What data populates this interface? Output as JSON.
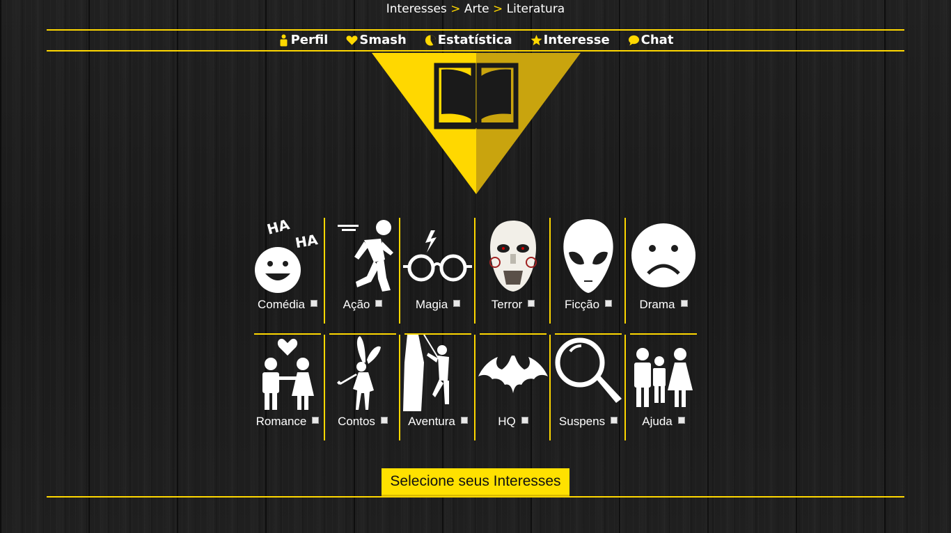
{
  "breadcrumb": {
    "items": [
      "Interesses",
      "Arte",
      "Literatura"
    ],
    "separator": ">"
  },
  "nav": {
    "items": [
      {
        "label": "Perfil",
        "icon": "person-icon"
      },
      {
        "label": "Smash",
        "icon": "heart-icon"
      },
      {
        "label": "Estatística",
        "icon": "pie-chart-icon"
      },
      {
        "label": "Interesse",
        "icon": "star-icon"
      },
      {
        "label": "Chat",
        "icon": "speech-bubble-icon"
      }
    ]
  },
  "hero": {
    "icon": "open-book-icon"
  },
  "genres": {
    "row1": [
      {
        "label": "Comédia",
        "icon": "laughing-face-icon"
      },
      {
        "label": "Ação",
        "icon": "running-man-icon"
      },
      {
        "label": "Magia",
        "icon": "glasses-lightning-icon"
      },
      {
        "label": "Terror",
        "icon": "jigsaw-mask-icon"
      },
      {
        "label": "Ficção",
        "icon": "alien-head-icon"
      },
      {
        "label": "Drama",
        "icon": "sad-face-icon"
      }
    ],
    "row2": [
      {
        "label": "Romance",
        "icon": "couple-heart-icon"
      },
      {
        "label": "Contos",
        "icon": "fairy-icon"
      },
      {
        "label": "Aventura",
        "icon": "climber-icon"
      },
      {
        "label": "HQ",
        "icon": "bat-symbol-icon"
      },
      {
        "label": "Suspens",
        "icon": "magnifier-icon"
      },
      {
        "label": "Ajuda",
        "icon": "family-icon"
      }
    ]
  },
  "actions": {
    "select_label": "Selecione seus Interesses"
  },
  "colors": {
    "accent": "#ffd800",
    "button": "#ffe100",
    "text": "#ffffff"
  }
}
